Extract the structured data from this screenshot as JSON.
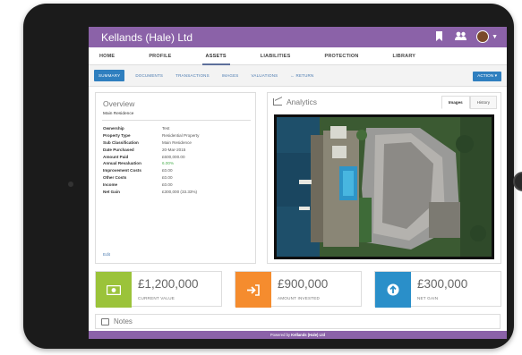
{
  "app": {
    "brand": "Kellands (Hale) Ltd"
  },
  "main_nav": [
    {
      "label": "HOME"
    },
    {
      "label": "PROFILE"
    },
    {
      "label": "ASSETS"
    },
    {
      "label": "LIABILITIES"
    },
    {
      "label": "PROTECTION"
    },
    {
      "label": "LIBRARY"
    }
  ],
  "sub_nav": [
    {
      "label": "SUMMARY"
    },
    {
      "label": "DOCUMENTS"
    },
    {
      "label": "TRANSACTIONS"
    },
    {
      "label": "IMAGES"
    },
    {
      "label": "VALUATIONS"
    },
    {
      "label": "← RETURN"
    }
  ],
  "action_label": "ACTION ▾",
  "overview": {
    "title": "Overview",
    "subtitle": "Main Residence",
    "rows": [
      {
        "key": "Ownership",
        "value": "Test"
      },
      {
        "key": "Property Type",
        "value": "Residential Property"
      },
      {
        "key": "Sub Classification",
        "value": "Main Residence"
      },
      {
        "key": "Date Purchased",
        "value": "20-Mar-2015"
      },
      {
        "key": "Amount Paid",
        "value": "£600,000.00"
      },
      {
        "key": "Annual Revaluation",
        "value": "6.00%"
      },
      {
        "key": "Improvement Costs",
        "value": "£0.00"
      },
      {
        "key": "Other Costs",
        "value": "£0.00"
      },
      {
        "key": "Income",
        "value": "£0.00"
      },
      {
        "key": "Net Gain",
        "value": "£300,000 (33.33%)"
      }
    ],
    "edit_label": "Edit"
  },
  "analytics": {
    "title": "Analytics",
    "tabs": [
      {
        "label": "Images"
      },
      {
        "label": "History"
      }
    ]
  },
  "stats": [
    {
      "value": "£1,200,000",
      "label": "CURRENT VALUE",
      "color": "#9bc33a",
      "icon": "banknote-icon"
    },
    {
      "value": "£900,000",
      "label": "AMOUNT INVESTED",
      "color": "#f58c2e",
      "icon": "sign-in-icon"
    },
    {
      "value": "£300,000",
      "label": "NET GAIN",
      "color": "#2a8fc9",
      "icon": "arrow-up-icon"
    }
  ],
  "notes": {
    "title": "Notes"
  },
  "footer": {
    "prefix": "Powered by ",
    "brand": "Kellands (Hale) Ltd"
  },
  "colors": {
    "topbar": "#8b62a8",
    "accent": "#2f7fbf"
  }
}
